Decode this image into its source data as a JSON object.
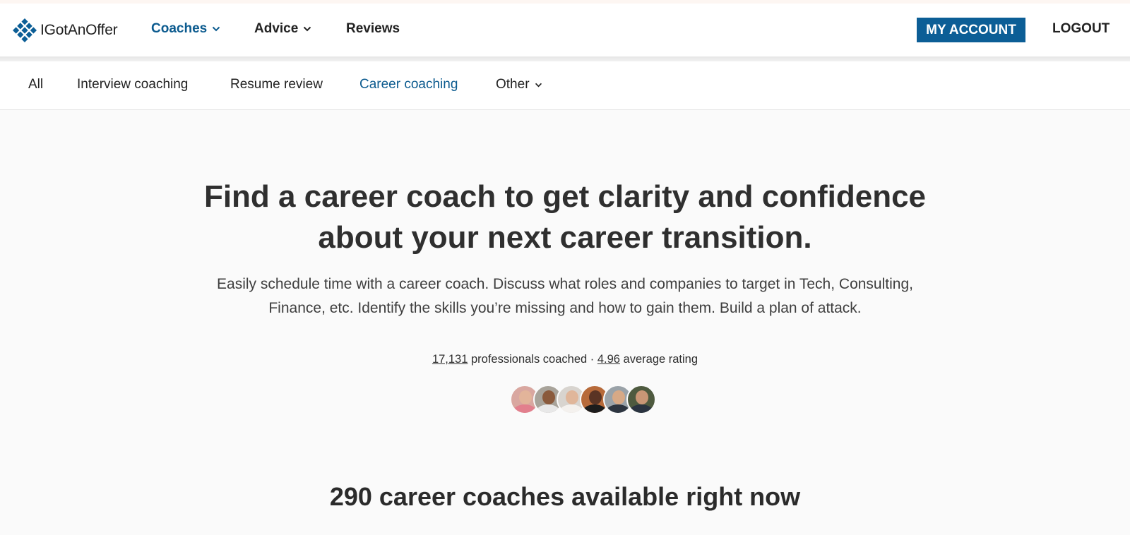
{
  "brand": {
    "name": "IGotAnOffer",
    "accent_color": "#0c5e96"
  },
  "header": {
    "nav": [
      {
        "label": "Coaches",
        "dropdown": true,
        "active": true
      },
      {
        "label": "Advice",
        "dropdown": true,
        "active": false
      },
      {
        "label": "Reviews",
        "dropdown": false,
        "active": false
      }
    ],
    "account_label": "MY ACCOUNT",
    "logout_label": "LOGOUT"
  },
  "subnav": {
    "items": [
      {
        "label": "All",
        "active": false
      },
      {
        "label": "Interview coaching",
        "active": false
      },
      {
        "label": "Resume review",
        "active": false
      },
      {
        "label": "Career coaching",
        "active": true
      },
      {
        "label": "Other",
        "active": false,
        "dropdown": true
      }
    ]
  },
  "hero": {
    "title_line1": "Find a career coach to get clarity and confidence",
    "title_line2": "about your next career transition.",
    "subtitle_line1": "Easily schedule time with a career coach. Discuss what roles and companies to target in Tech, Consulting,",
    "subtitle_line2": "Finance, etc. Identify the skills you’re missing and how to gain them. Build a plan of attack."
  },
  "stats": {
    "coached_count": "17,131",
    "coached_label": " professionals coached · ",
    "rating": "4.96",
    "rating_label": " average rating"
  },
  "avatars": [
    {
      "name": "coach-avatar-1",
      "bg": "#d9a7a0",
      "skin": "#e2b49a",
      "shirt": "#e27f8d"
    },
    {
      "name": "coach-avatar-2",
      "bg": "#a8a39a",
      "skin": "#8a5a3c",
      "shirt": "#e8e8e8"
    },
    {
      "name": "coach-avatar-3",
      "bg": "#d8d4cf",
      "skin": "#e0b69a",
      "shirt": "#f4f1ee"
    },
    {
      "name": "coach-avatar-4",
      "bg": "#b76a3a",
      "skin": "#5a3424",
      "shirt": "#1c1c1c"
    },
    {
      "name": "coach-avatar-5",
      "bg": "#9aa2a8",
      "skin": "#d7a986",
      "shirt": "#2d3540"
    },
    {
      "name": "coach-avatar-6",
      "bg": "#4e5a3f",
      "skin": "#c99676",
      "shirt": "#2a3340"
    }
  ],
  "results": {
    "title": "290 career coaches available right now"
  }
}
